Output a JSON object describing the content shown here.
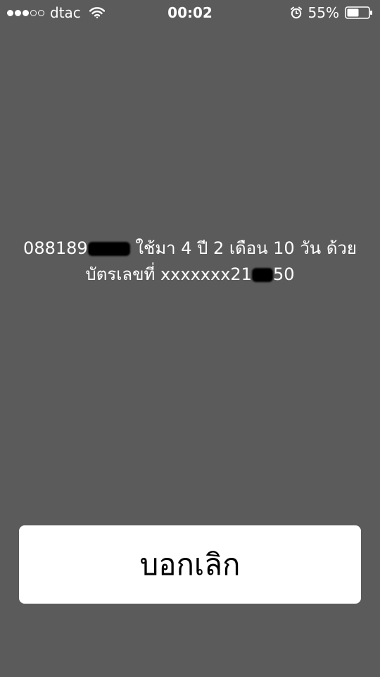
{
  "status_bar": {
    "signal_bars_filled": 3,
    "signal_bars_total": 5,
    "carrier": "dtac",
    "time": "00:02",
    "battery_percent": "55%",
    "battery_level": 0.55,
    "icons": [
      "signal-dots-icon",
      "wifi-icon",
      "alarm-clock-icon",
      "battery-icon"
    ]
  },
  "message": {
    "phone_prefix": "088189",
    "line1_rest": "ใช้มา 4 ปี 2 เดือน 10 วัน ด้วย",
    "line2_prefix": "บัตรเลขที่ xxxxxxx21",
    "line2_suffix": "50"
  },
  "cancel_button": {
    "label": "บอกเลิก"
  },
  "colors": {
    "background": "#5b5b5b",
    "text": "#ffffff",
    "button_bg": "#ffffff",
    "button_text": "#000000",
    "redaction": "#000000"
  }
}
